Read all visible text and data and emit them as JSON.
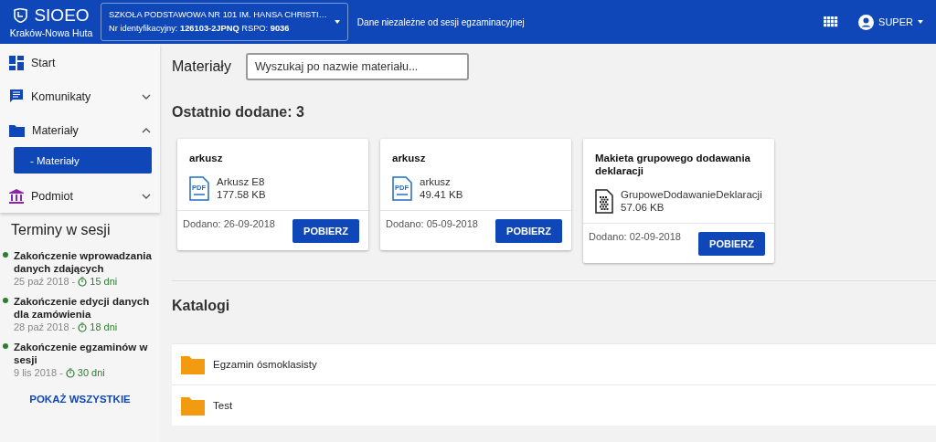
{
  "header": {
    "app_name": "SIOEO",
    "region": "Kraków-Nowa Huta",
    "school": {
      "name": "SZKOŁA PODSTAWOWA NR 101 IM. HANSA CHRISTI…",
      "id_label": "Nr identyfikacyjny:",
      "id_value": "126103-2JPNQ",
      "rspo_label": "RSPO:",
      "rspo_value": "9036"
    },
    "context": "Dane niezależne od sesji egzaminacyjnej",
    "user": "SUPER"
  },
  "sidebar": {
    "items": [
      {
        "label": "Start"
      },
      {
        "label": "Komunikaty",
        "expanded": false
      },
      {
        "label": "Materiały",
        "expanded": true,
        "children": [
          {
            "label": "- Materiały",
            "selected": true
          }
        ]
      },
      {
        "label": "Podmiot",
        "expanded": false
      }
    ],
    "terms_title": "Terminy w sesji",
    "terms": [
      {
        "title": "Zakończenie wprowadzania danych zdających",
        "date": "25 paź 2018 -",
        "remaining": "15 dni",
        "color": "#2e7d32"
      },
      {
        "title": "Zakończenie edycji danych dla zamówienia",
        "date": "28 paź 2018 -",
        "remaining": "18 dni",
        "color": "#2e7d32"
      },
      {
        "title": "Zakończenie egzaminów w sesji",
        "date": "9 lis 2018 -",
        "remaining": "30 dni",
        "color": "#2e7d32"
      }
    ],
    "show_all": "POKAŻ WSZYSTKIE"
  },
  "main": {
    "title": "Materiały",
    "search": {
      "placeholder": "Wyszukaj po nazwie materiału..."
    },
    "recent_title": "Ostatnio dodane: 3",
    "cards": [
      {
        "title": "arkusz",
        "file_label": "PDF",
        "file_name": "Arkusz E8",
        "size": "177.58 KB",
        "added": "Dodano: 26-09-2018",
        "button": "POBIERZ"
      },
      {
        "title": "arkusz",
        "file_label": "PDF",
        "file_name": "arkusz",
        "size": "49.41 KB",
        "added": "Dodano: 05-09-2018",
        "button": "POBIERZ"
      },
      {
        "title": "Makieta grupowego dodawania deklaracji",
        "file_name": "GrupoweDodawanieDeklaracji",
        "size": "57.06 KB",
        "added": "Dodano: 02-09-2018",
        "button": "POBIERZ"
      }
    ],
    "catalogs_title": "Katalogi",
    "catalogs": [
      {
        "name": "Egzamin ósmoklasisty"
      },
      {
        "name": "Test"
      }
    ]
  }
}
